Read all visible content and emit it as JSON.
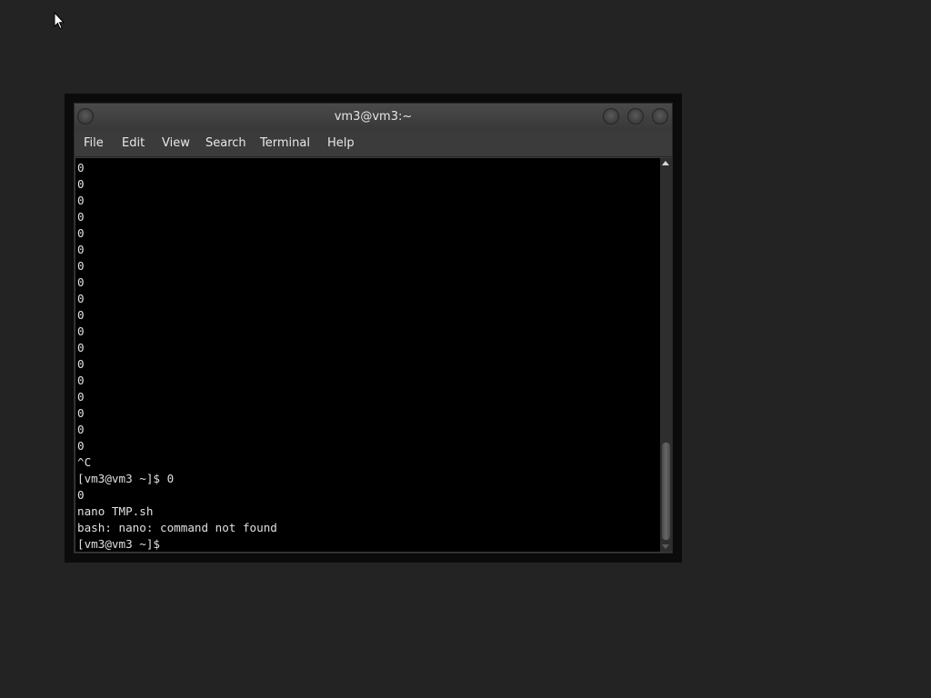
{
  "window": {
    "title": "vm3@vm3:~"
  },
  "menubar": {
    "items": [
      "File",
      "Edit",
      "View",
      "Search",
      "Terminal",
      "Help"
    ]
  },
  "terminal": {
    "lines": [
      "0",
      "0",
      "0",
      "0",
      "0",
      "0",
      "0",
      "0",
      "0",
      "0",
      "0",
      "0",
      "0",
      "0",
      "0",
      "0",
      "0",
      "0",
      "^C",
      "[vm3@vm3 ~]$ 0",
      "0",
      "nano TMP.sh",
      "bash: nano: command not found",
      "[vm3@vm3 ~]$ "
    ]
  },
  "icons": {
    "cursor": "mouse-pointer-icon",
    "menu": "window-menu-icon",
    "minimize": "minimize-icon",
    "maximize": "maximize-icon",
    "close": "close-icon",
    "scroll_up": "scroll-up-arrow-icon",
    "scroll_down": "scroll-down-arrow-icon"
  },
  "colors": {
    "desktop_bg": "#232323",
    "terminal_bg": "#000000",
    "terminal_fg": "#e0e0e0"
  }
}
